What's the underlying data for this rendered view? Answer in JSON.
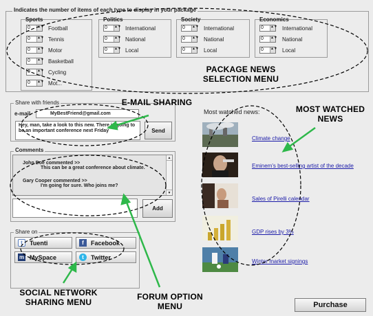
{
  "package": {
    "legend": "Indicates the number of items of each type to display in your package",
    "categories": [
      {
        "title": "Sports",
        "items": [
          "Football",
          "Tennis",
          "Motor",
          "Basketball",
          "Cycling",
          "Mot..."
        ]
      },
      {
        "title": "Politics",
        "items": [
          "International",
          "National",
          "Local"
        ]
      },
      {
        "title": "Society",
        "items": [
          "International",
          "National",
          "Local"
        ]
      },
      {
        "title": "Economics",
        "items": [
          "International",
          "National",
          "Local"
        ]
      }
    ],
    "spin_value": "0"
  },
  "share": {
    "legend": "Share with friends",
    "email_label": "e-mail",
    "email_value": "MyBestFriend@gmail.com",
    "message": "Hey, man, take a look to this new. There is going to be an important conference next Friday",
    "send_label": "Send"
  },
  "comments": {
    "legend": "Comments",
    "entries": [
      {
        "head": "John Doe commented >>",
        "body": "This can be a great conference about climate."
      },
      {
        "head": "Gary Cooper commented >>",
        "body": "I'm going for sure. Who joins me?"
      }
    ],
    "add_label": "Add"
  },
  "social": {
    "legend": "Share on",
    "buttons": [
      {
        "label": "Tuenti",
        "icon": "tuenti-icon",
        "color": "#5a7fbf"
      },
      {
        "label": "Facebook",
        "icon": "facebook-icon",
        "color": "#3b5998"
      },
      {
        "label": "MySpace",
        "icon": "myspace-icon",
        "color": "#1f3a73"
      },
      {
        "label": "Twitter",
        "icon": "twitter-icon",
        "color": "#2fb6e9"
      }
    ]
  },
  "news": {
    "heading": "Most watched news:",
    "items": [
      {
        "title": "Climate change",
        "thumb": "climate-photo"
      },
      {
        "title": "Eminem's best-selling artist of the decade",
        "thumb": "eminem-photo"
      },
      {
        "title": "Sales of Pirelli calendar",
        "thumb": "calendar-photo"
      },
      {
        "title": "GDP rises by 3%",
        "thumb": "gdp-chart-photo"
      },
      {
        "title": "Winter market signings",
        "thumb": "football-photo"
      }
    ]
  },
  "purchase_label": "Purchase",
  "annotations": {
    "package_menu": [
      "PACKAGE NEWS",
      "SELECTION MENU"
    ],
    "email_sharing": "E-MAIL SHARING",
    "most_watched": [
      "MOST WATCHED",
      "NEWS"
    ],
    "social_menu": [
      "SOCIAL NETWORK",
      "SHARING MENU"
    ],
    "forum_option": [
      "FORUM OPTION",
      "MENU"
    ]
  },
  "colors": {
    "annotation_arrow": "#2eb84a",
    "link": "#1a1aa8"
  }
}
